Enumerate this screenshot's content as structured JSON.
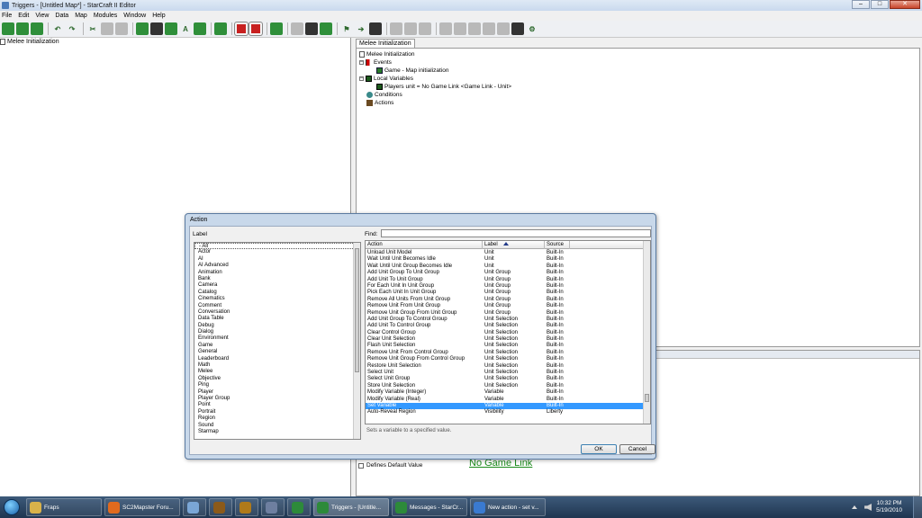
{
  "window": {
    "title": "Triggers - [Untitled Map*] - StarCraft II Editor",
    "controls": [
      "–",
      "□",
      "✕"
    ]
  },
  "menu": [
    "File",
    "Edit",
    "View",
    "Data",
    "Map",
    "Modules",
    "Window",
    "Help"
  ],
  "left_tree": {
    "root": "Melee Initialization"
  },
  "trigger": {
    "tab": "Melee Initialization",
    "name": "Melee Initialization",
    "events_label": "Events",
    "event_item": "Game - Map initialization",
    "local_vars_label": "Local Variables",
    "local_var_item": "Players unit = No Game Link <Game Link - Unit>",
    "conditions_label": "Conditions",
    "actions_label": "Actions"
  },
  "lower_panel": {
    "defines_default": "Defines Default Value",
    "value_link": "No Game Link"
  },
  "dialog": {
    "title": "Action",
    "label_header": "Label",
    "find_label": "Find:",
    "find_value": "",
    "categories": [
      "- All",
      "Actor",
      "AI",
      "AI Advanced",
      "Animation",
      "Bank",
      "Camera",
      "Catalog",
      "Cinematics",
      "Comment",
      "Conversation",
      "Data Table",
      "Debug",
      "Dialog",
      "Environment",
      "Game",
      "General",
      "Leaderboard",
      "Math",
      "Melee",
      "Objective",
      "Ping",
      "Player",
      "Player Group",
      "Point",
      "Portrait",
      "Region",
      "Sound",
      "Starmap"
    ],
    "columns": {
      "action": "Action",
      "label": "Label",
      "source": "Source"
    },
    "rows": [
      {
        "action": "Unload Unit Model",
        "label": "Unit",
        "source": "Built-In"
      },
      {
        "action": "Wait Until Unit Becomes Idle",
        "label": "Unit",
        "source": "Built-In"
      },
      {
        "action": "Wait Until Unit Group Becomes Idle",
        "label": "Unit",
        "source": "Built-In"
      },
      {
        "action": "Add Unit Group To Unit Group",
        "label": "Unit Group",
        "source": "Built-In"
      },
      {
        "action": "Add Unit To Unit Group",
        "label": "Unit Group",
        "source": "Built-In"
      },
      {
        "action": "For Each Unit In Unit Group",
        "label": "Unit Group",
        "source": "Built-In"
      },
      {
        "action": "Pick Each Unit In Unit Group",
        "label": "Unit Group",
        "source": "Built-In"
      },
      {
        "action": "Remove All Units From Unit Group",
        "label": "Unit Group",
        "source": "Built-In"
      },
      {
        "action": "Remove Unit From Unit Group",
        "label": "Unit Group",
        "source": "Built-In"
      },
      {
        "action": "Remove Unit Group From Unit Group",
        "label": "Unit Group",
        "source": "Built-In"
      },
      {
        "action": "Add Unit Group To Control Group",
        "label": "Unit Selection",
        "source": "Built-In"
      },
      {
        "action": "Add Unit To Control Group",
        "label": "Unit Selection",
        "source": "Built-In"
      },
      {
        "action": "Clear Control Group",
        "label": "Unit Selection",
        "source": "Built-In"
      },
      {
        "action": "Clear Unit Selection",
        "label": "Unit Selection",
        "source": "Built-In"
      },
      {
        "action": "Flash Unit Selection",
        "label": "Unit Selection",
        "source": "Built-In"
      },
      {
        "action": "Remove Unit From Control Group",
        "label": "Unit Selection",
        "source": "Built-In"
      },
      {
        "action": "Remove Unit Group From Control Group",
        "label": "Unit Selection",
        "source": "Built-In"
      },
      {
        "action": "Restore Unit Selection",
        "label": "Unit Selection",
        "source": "Built-In"
      },
      {
        "action": "Select Unit",
        "label": "Unit Selection",
        "source": "Built-In"
      },
      {
        "action": "Select Unit Group",
        "label": "Unit Selection",
        "source": "Built-In"
      },
      {
        "action": "Store Unit Selection",
        "label": "Unit Selection",
        "source": "Built-In"
      },
      {
        "action": "Modify Variable (Integer)",
        "label": "Variable",
        "source": "Built-In"
      },
      {
        "action": "Modify Variable (Real)",
        "label": "Variable",
        "source": "Built-In"
      },
      {
        "action": "Set Variable",
        "label": "Variable",
        "source": "Built-In",
        "selected": true
      },
      {
        "action": "Auto-Reveal Region",
        "label": "Visibility",
        "source": "Liberty"
      }
    ],
    "description": "Sets a variable to a specified value.",
    "ok": "OK",
    "cancel": "Cancel"
  },
  "taskbar": {
    "items": [
      {
        "label": "Fraps",
        "color": "#d9b24a"
      },
      {
        "label": "SC2Mapster Foru...",
        "color": "#e06a1e"
      },
      {
        "label": "",
        "color": "#7aa6d6"
      },
      {
        "label": "",
        "color": "#8b5a1a"
      },
      {
        "label": "",
        "color": "#b07a1a"
      },
      {
        "label": "",
        "color": "#6e7fa0"
      },
      {
        "label": "",
        "color": "#2d8a3a"
      },
      {
        "label": "Triggers - [Untitle...",
        "color": "#2d8a3a",
        "active": true
      },
      {
        "label": "Messages - StarCr...",
        "color": "#2d8a3a"
      },
      {
        "label": "New action - set v...",
        "color": "#3a7ad0"
      }
    ],
    "time": "10:32 PM",
    "date": "5/19/2010"
  }
}
